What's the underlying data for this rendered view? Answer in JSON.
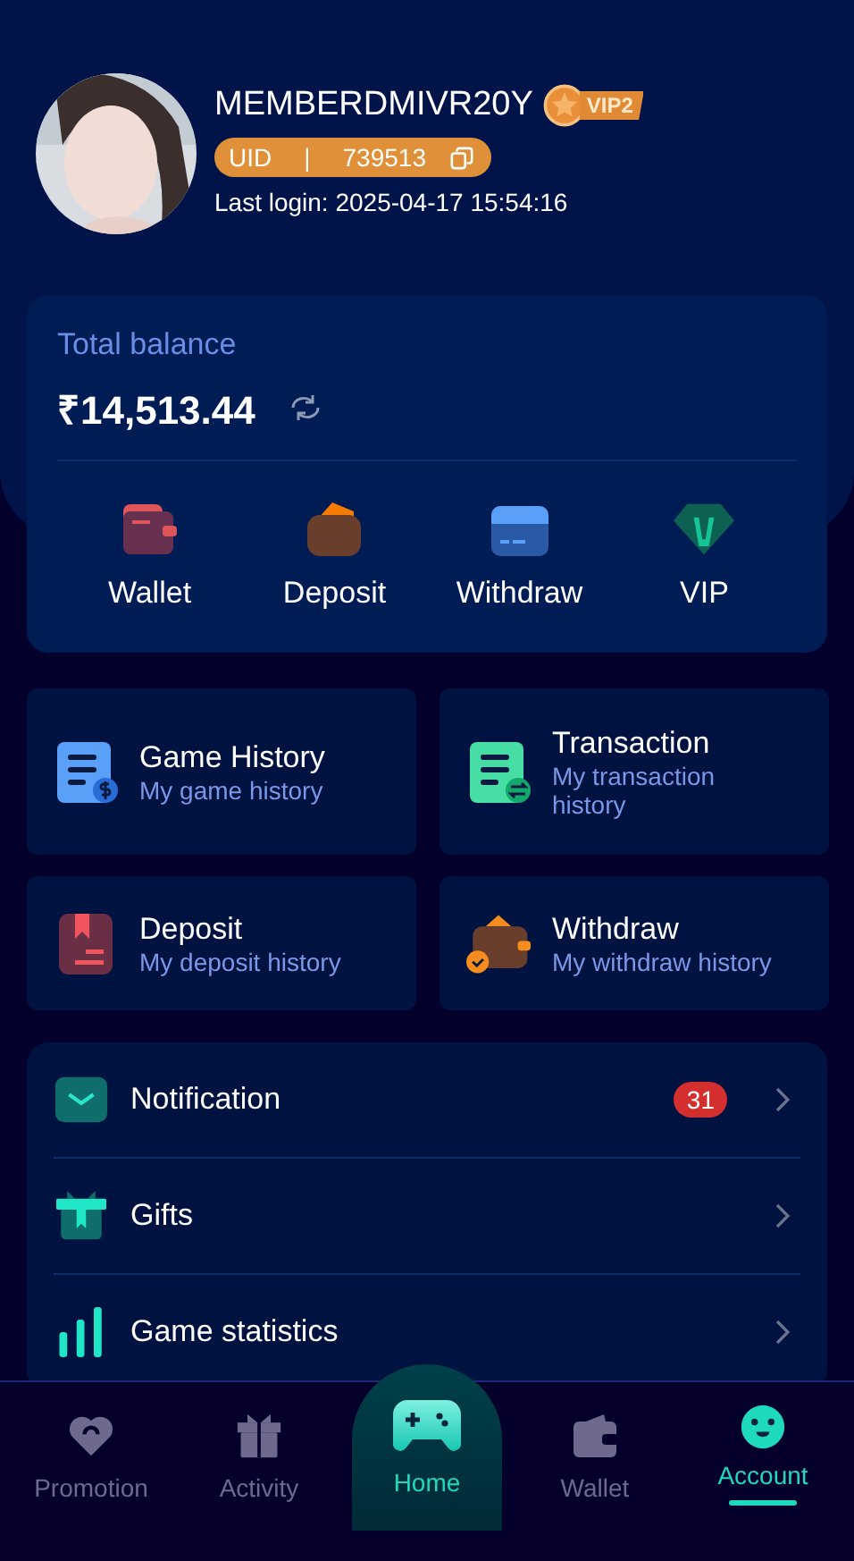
{
  "profile": {
    "name": "MEMBERDMIVR20Y",
    "vip_badge": "VIP2",
    "uid_label": "UID",
    "uid_separator": "|",
    "uid": "739513",
    "last_login": "Last login: 2025-04-17 15:54:16"
  },
  "balance": {
    "label": "Total balance",
    "amount": "₹14,513.44"
  },
  "actions": [
    {
      "label": "Wallet",
      "kind": "wallet"
    },
    {
      "label": "Deposit",
      "kind": "deposit"
    },
    {
      "label": "Withdraw",
      "kind": "withdraw"
    },
    {
      "label": "VIP",
      "kind": "vip"
    }
  ],
  "history": [
    {
      "title": "Game History",
      "subtitle": "My game history",
      "kind": "game"
    },
    {
      "title": "Transaction",
      "subtitle": "My transaction history",
      "kind": "transaction"
    },
    {
      "title": "Deposit",
      "subtitle": "My deposit history",
      "kind": "deposit"
    },
    {
      "title": "Withdraw",
      "subtitle": "My withdraw history",
      "kind": "withdraw"
    }
  ],
  "menu": [
    {
      "label": "Notification",
      "kind": "notification",
      "badge": "31"
    },
    {
      "label": "Gifts",
      "kind": "gifts"
    },
    {
      "label": "Game statistics",
      "kind": "stats"
    }
  ],
  "nav": [
    {
      "label": "Promotion",
      "kind": "promotion",
      "selected": false
    },
    {
      "label": "Activity",
      "kind": "activity",
      "selected": false
    },
    {
      "label": "Home",
      "kind": "home",
      "selected": false
    },
    {
      "label": "Wallet",
      "kind": "wallet",
      "selected": false
    },
    {
      "label": "Account",
      "kind": "account",
      "selected": true
    }
  ]
}
